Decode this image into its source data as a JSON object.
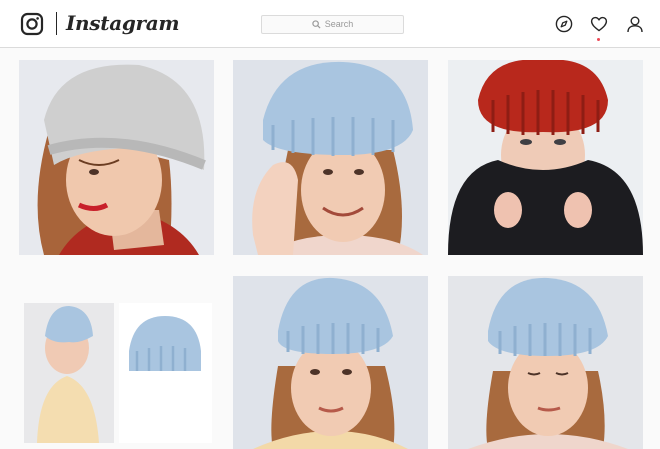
{
  "header": {
    "brand": "Instagram",
    "search_placeholder": "Search",
    "icons": [
      "instagram-camera-icon",
      "search-icon",
      "compass-icon",
      "heart-icon",
      "user-icon"
    ],
    "notification_dot_color": "#ed4956"
  },
  "posts": [
    {
      "subject": "woman-grey-beanie-red-sweater",
      "hat_color": "#c9c9c9"
    },
    {
      "subject": "woman-light-blue-beanie-smiling",
      "hat_color": "#a9c5e0"
    },
    {
      "subject": "woman-red-beanie-fur-coat",
      "hat_color": "#b8281c"
    },
    {
      "subject": "collage-blue-beanie-flatlay",
      "hat_color": "#a9c5e0"
    },
    {
      "subject": "woman-blue-beanie-portrait",
      "hat_color": "#a9c5e0"
    },
    {
      "subject": "woman-blue-beanie-eyes-closed",
      "hat_color": "#a9c5e0"
    }
  ]
}
